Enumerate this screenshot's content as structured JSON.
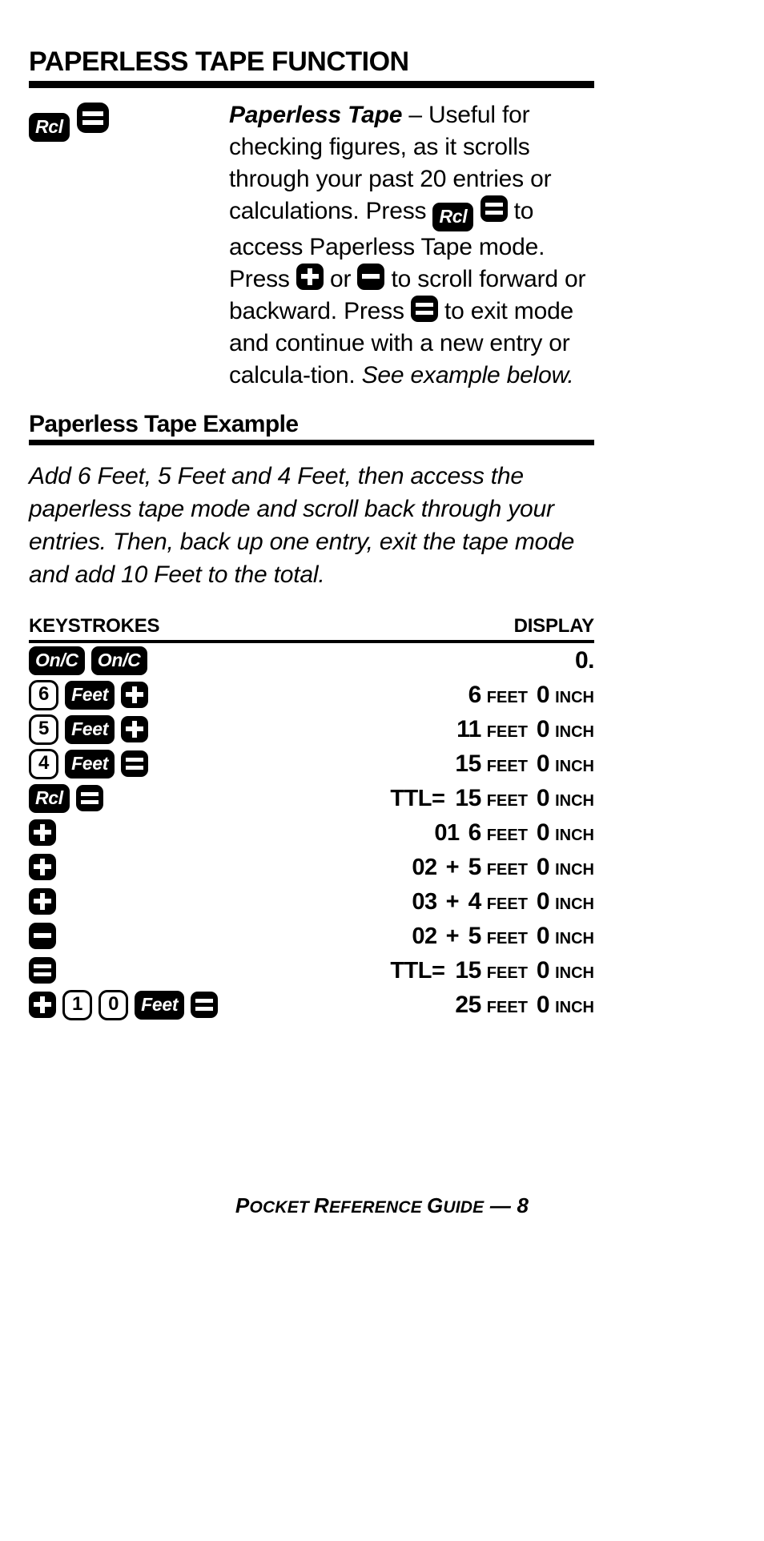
{
  "page": {
    "section_title": "PAPERLESS TAPE FUNCTION",
    "footer": {
      "part1": "P",
      "part2": "OCKET ",
      "part3": "R",
      "part4": "EFERENCE ",
      "part5": "G",
      "part6": "UIDE",
      "part7": " — 8"
    }
  },
  "description": {
    "keys": [
      {
        "type": "text",
        "label": "Rcl",
        "name": "rcl-key"
      },
      {
        "type": "equals",
        "label": "=",
        "name": "equals-key"
      }
    ],
    "term": "Paperless Tape",
    "dash": " – ",
    "body_1": "Useful for checking figures, as it scrolls through your past 20 entries or calculations. Press ",
    "body_2": " to access Paperless Tape mode. Press ",
    "body_3": " or ",
    "body_4": " to scroll forward or backward. Press ",
    "body_5": " to exit mode and continue with a new entry or calcula-tion. ",
    "italic_tail": "See example below."
  },
  "example": {
    "heading": "Paperless Tape Example",
    "intro": "Add 6 Feet, 5 Feet and 4 Feet, then access the paperless tape mode and scroll back through your entries. Then, back up one entry, exit the tape mode and add 10 Feet to the total."
  },
  "table": {
    "col_keystrokes": "KEYSTROKES",
    "col_display": "DISPLAY",
    "rows": [
      {
        "keys": [
          {
            "type": "text",
            "label": "On/C",
            "name": "onc-key"
          },
          {
            "type": "text",
            "label": "On/C",
            "name": "onc-key"
          }
        ],
        "display": {
          "total": "",
          "index": "",
          "op": "",
          "value": "0.",
          "unit1": "",
          "unit2_value": "",
          "unit2": ""
        }
      },
      {
        "keys": [
          {
            "type": "num",
            "label": "6",
            "name": "digit-6-key"
          },
          {
            "type": "text",
            "label": "Feet",
            "name": "feet-key"
          },
          {
            "type": "plus",
            "label": "+",
            "name": "plus-key"
          }
        ],
        "display": {
          "total": "",
          "index": "",
          "op": "",
          "value": "6",
          "unit1": "FEET",
          "unit2_value": "0",
          "unit2": "INCH"
        }
      },
      {
        "keys": [
          {
            "type": "num",
            "label": "5",
            "name": "digit-5-key"
          },
          {
            "type": "text",
            "label": "Feet",
            "name": "feet-key"
          },
          {
            "type": "plus",
            "label": "+",
            "name": "plus-key"
          }
        ],
        "display": {
          "total": "",
          "index": "",
          "op": "",
          "value": "11",
          "unit1": "FEET",
          "unit2_value": "0",
          "unit2": "INCH"
        }
      },
      {
        "keys": [
          {
            "type": "num",
            "label": "4",
            "name": "digit-4-key"
          },
          {
            "type": "text",
            "label": "Feet",
            "name": "feet-key"
          },
          {
            "type": "equals",
            "label": "=",
            "name": "equals-key"
          }
        ],
        "display": {
          "total": "",
          "index": "",
          "op": "",
          "value": "15",
          "unit1": "FEET",
          "unit2_value": "0",
          "unit2": "INCH"
        }
      },
      {
        "keys": [
          {
            "type": "text",
            "label": "Rcl",
            "name": "rcl-key"
          },
          {
            "type": "equals",
            "label": "=",
            "name": "equals-key"
          }
        ],
        "display": {
          "total": "TTL=",
          "index": "",
          "op": "",
          "value": "15",
          "unit1": "FEET",
          "unit2_value": "0",
          "unit2": "INCH"
        }
      },
      {
        "keys": [
          {
            "type": "plus",
            "label": "+",
            "name": "plus-key"
          }
        ],
        "display": {
          "total": "",
          "index": "01",
          "op": "",
          "value": "6",
          "unit1": "FEET",
          "unit2_value": "0",
          "unit2": "INCH"
        }
      },
      {
        "keys": [
          {
            "type": "plus",
            "label": "+",
            "name": "plus-key"
          }
        ],
        "display": {
          "total": "",
          "index": "02",
          "op": "+",
          "value": "5",
          "unit1": "FEET",
          "unit2_value": "0",
          "unit2": "INCH"
        }
      },
      {
        "keys": [
          {
            "type": "plus",
            "label": "+",
            "name": "plus-key"
          }
        ],
        "display": {
          "total": "",
          "index": "03",
          "op": "+",
          "value": "4",
          "unit1": "FEET",
          "unit2_value": "0",
          "unit2": "INCH"
        }
      },
      {
        "keys": [
          {
            "type": "minus",
            "label": "−",
            "name": "minus-key"
          }
        ],
        "display": {
          "total": "",
          "index": "02",
          "op": "+",
          "value": "5",
          "unit1": "FEET",
          "unit2_value": "0",
          "unit2": "INCH"
        }
      },
      {
        "keys": [
          {
            "type": "equals",
            "label": "=",
            "name": "equals-key"
          }
        ],
        "display": {
          "total": "TTL=",
          "index": "",
          "op": "",
          "value": "15",
          "unit1": "FEET",
          "unit2_value": "0",
          "unit2": "INCH"
        }
      },
      {
        "keys": [
          {
            "type": "plus",
            "label": "+",
            "name": "plus-key"
          },
          {
            "type": "num",
            "label": "1",
            "name": "digit-1-key"
          },
          {
            "type": "num",
            "label": "0",
            "name": "digit-0-key"
          },
          {
            "type": "text",
            "label": "Feet",
            "name": "feet-key"
          },
          {
            "type": "equals",
            "label": "=",
            "name": "equals-key"
          }
        ],
        "display": {
          "total": "",
          "index": "",
          "op": "",
          "value": "25",
          "unit1": "FEET",
          "unit2_value": "0",
          "unit2": "INCH"
        }
      }
    ]
  }
}
